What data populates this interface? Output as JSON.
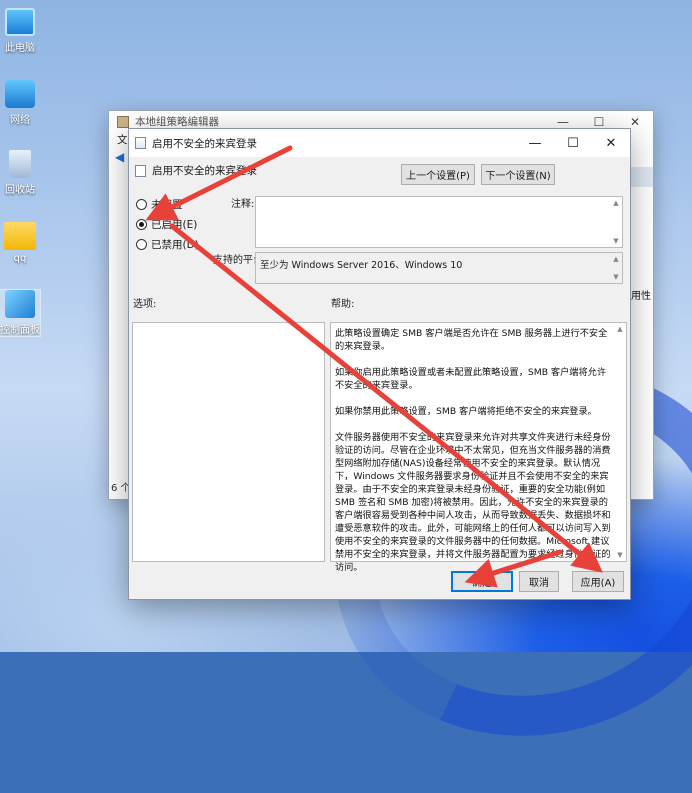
{
  "desktop": {
    "icons": [
      {
        "label": "此电脑",
        "kind": "pc"
      },
      {
        "label": "网络",
        "kind": "net"
      },
      {
        "label": "回收站",
        "kind": "bin"
      },
      {
        "label": "qq",
        "kind": "folder"
      },
      {
        "label": "控制面板",
        "kind": "cp"
      }
    ]
  },
  "back_window": {
    "title": "本地组策略编辑器",
    "menu_first": "文",
    "right_label": "用性",
    "status": "6 个"
  },
  "dialog": {
    "title": "启用不安全的来宾登录",
    "subtitle": "启用不安全的来宾登录",
    "prev_button": "上一个设置(P)",
    "next_button": "下一个设置(N)",
    "radios": [
      {
        "label": "未配置",
        "selected": false
      },
      {
        "label": "已启用(E)",
        "selected": true
      },
      {
        "label": "已禁用(D)",
        "selected": false
      }
    ],
    "comment_label": "注释:",
    "supported_label": "支持的平台:",
    "supported_value": "至少为 Windows Server 2016、Windows 10",
    "options_label": "选项:",
    "help_label": "帮助:",
    "help_paragraphs": [
      "此策略设置确定 SMB 客户端是否允许在 SMB 服务器上进行不安全的来宾登录。",
      "如果你启用此策略设置或者未配置此策略设置，SMB 客户端将允许不安全的来宾登录。",
      "如果你禁用此策略设置，SMB 客户端将拒绝不安全的来宾登录。",
      "文件服务器使用不安全的来宾登录来允许对共享文件夹进行未经身份验证的访问。尽管在企业环境中不太常见，但充当文件服务器的消费型网络附加存储(NAS)设备经常使用不安全的来宾登录。默认情况下，Windows 文件服务器要求身份验证并且不会使用不安全的来宾登录。由于不安全的来宾登录未经身份验证，重要的安全功能(例如 SMB 签名和 SMB 加密)将被禁用。因此，允许不安全的来宾登录的客户端很容易受到各种中间人攻击，从而导致数据丢失、数据损坏和遭受恶意软件的攻击。此外，可能网络上的任何人都可以访问写入到使用不安全的来宾登录的文件服务器中的任何数据。Microsoft 建议禁用不安全的来宾登录，并将文件服务器配置为要求经过身份验证的访问。"
    ],
    "ok_button": "确定",
    "cancel_button": "取消",
    "apply_button": "应用(A)",
    "title_controls": {
      "minimize": "—",
      "maximize": "☐",
      "close": "✕"
    }
  },
  "annotations": {
    "arrow_color": "#e8413a"
  }
}
